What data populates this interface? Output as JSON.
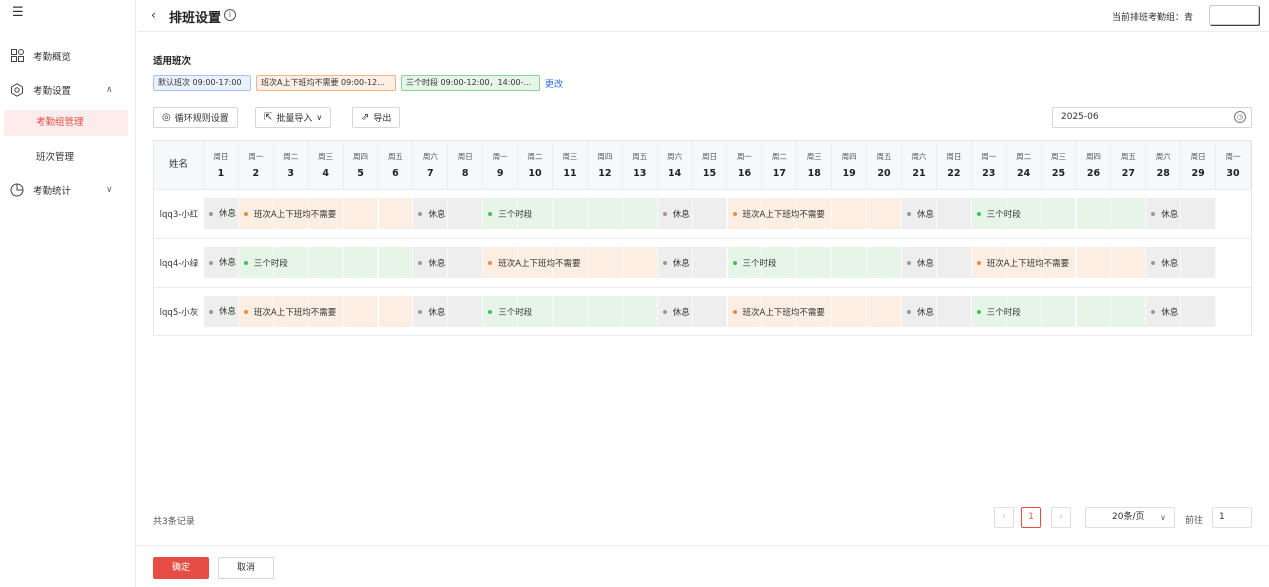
{
  "sidebar": {
    "items": [
      {
        "label": "考勤概览",
        "icon": "grid-icon"
      },
      {
        "label": "考勤设置",
        "icon": "settings-icon"
      },
      {
        "label": "考勤统计",
        "icon": "pie-chart-icon"
      }
    ],
    "sub_items": [
      {
        "label": "考勤组管理",
        "active": true
      },
      {
        "label": "班次管理",
        "active": false
      }
    ]
  },
  "header": {
    "title": "排班设置",
    "group_label": "当前排班考勤组：",
    "group_value": "青"
  },
  "shifts": {
    "title": "适用班次",
    "tags": [
      "默认班次 09:00-17:00",
      "班次A上下班均不需要 09:00-12...",
      "三个时段 09:00-12:00，14:00-..."
    ],
    "change_label": "更改"
  },
  "toolbar": {
    "cycle_label": "循环规则设置",
    "import_label": "批量导入",
    "export_label": "导出",
    "month": "2025-06"
  },
  "table": {
    "name_header": "姓名",
    "weekdays": [
      "周日",
      "周一",
      "周二",
      "周三",
      "周四",
      "周五",
      "周六",
      "周日",
      "周一",
      "周二",
      "周三",
      "周四",
      "周五",
      "周六",
      "周日",
      "周一",
      "周二",
      "周三",
      "周四",
      "周五",
      "周六",
      "周日",
      "周一",
      "周二",
      "周三",
      "周四",
      "周五",
      "周六",
      "周日",
      "周一"
    ],
    "days": [
      "1",
      "2",
      "3",
      "4",
      "5",
      "6",
      "7",
      "8",
      "9",
      "10",
      "11",
      "12",
      "13",
      "14",
      "15",
      "16",
      "17",
      "18",
      "19",
      "20",
      "21",
      "22",
      "23",
      "24",
      "25",
      "26",
      "27",
      "28",
      "29",
      "30"
    ],
    "shift_names": {
      "r": "休息",
      "a": "班次A上下班均不需要",
      "t": "三个时段"
    },
    "rows": [
      {
        "name": "lqq3-小红",
        "blocks": [
          [
            "r",
            1,
            1
          ],
          [
            "a",
            2,
            6
          ],
          [
            "r",
            7,
            8
          ],
          [
            "t",
            9,
            13
          ],
          [
            "r",
            14,
            15
          ],
          [
            "a",
            16,
            20
          ],
          [
            "r",
            21,
            22
          ],
          [
            "t",
            23,
            27
          ],
          [
            "r",
            28,
            29
          ]
        ]
      },
      {
        "name": "lqq4-小绿",
        "blocks": [
          [
            "r",
            1,
            1
          ],
          [
            "t",
            2,
            6
          ],
          [
            "r",
            7,
            8
          ],
          [
            "a",
            9,
            13
          ],
          [
            "r",
            14,
            15
          ],
          [
            "t",
            16,
            20
          ],
          [
            "r",
            21,
            22
          ],
          [
            "a",
            23,
            27
          ],
          [
            "r",
            28,
            29
          ]
        ]
      },
      {
        "name": "lqq5-小灰",
        "blocks": [
          [
            "r",
            1,
            1
          ],
          [
            "a",
            2,
            6
          ],
          [
            "r",
            7,
            8
          ],
          [
            "t",
            9,
            13
          ],
          [
            "r",
            14,
            15
          ],
          [
            "a",
            16,
            20
          ],
          [
            "r",
            21,
            22
          ],
          [
            "t",
            23,
            27
          ],
          [
            "r",
            28,
            29
          ]
        ]
      }
    ]
  },
  "pagination": {
    "total": "共3条记录",
    "current_page": "1",
    "page_size": "20条/页",
    "goto_label": "前往",
    "goto_value": "1"
  },
  "footer": {
    "ok_label": "确定",
    "cancel_label": "取消"
  },
  "colors": {
    "accent": "#e64e45",
    "link": "#2f6fe0"
  }
}
